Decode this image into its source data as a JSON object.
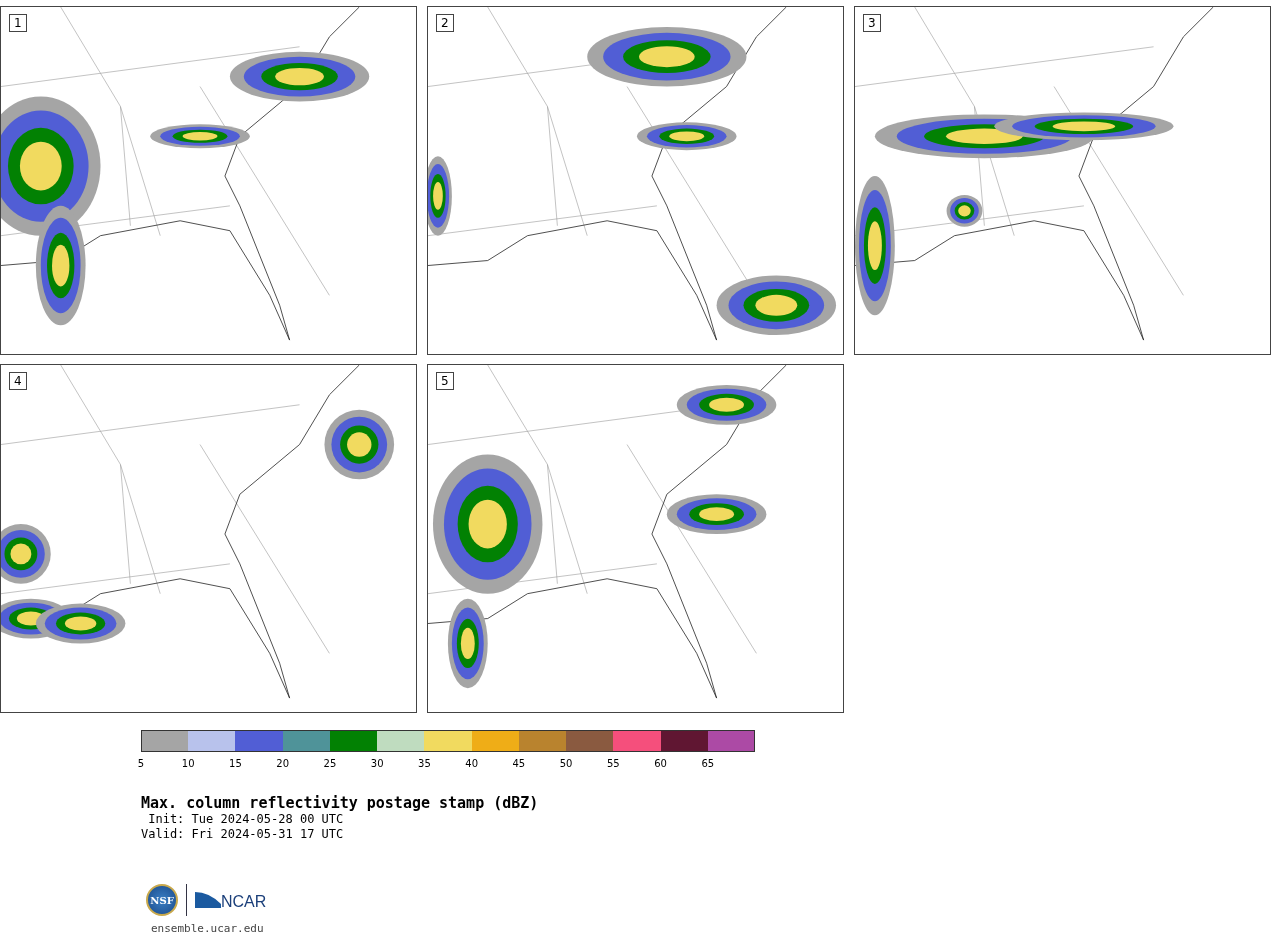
{
  "panels": [
    {
      "label": "1"
    },
    {
      "label": "2"
    },
    {
      "label": "3"
    },
    {
      "label": "4"
    },
    {
      "label": "5"
    }
  ],
  "colorbar": [
    {
      "label": "5",
      "color": "#a5a5a5"
    },
    {
      "label": "10",
      "color": "#b8c2ec"
    },
    {
      "label": "15",
      "color": "#515ed5"
    },
    {
      "label": "20",
      "color": "#4f9399"
    },
    {
      "label": "25",
      "color": "#028103"
    },
    {
      "label": "30",
      "color": "#bfdcbf"
    },
    {
      "label": "35",
      "color": "#f1da5f"
    },
    {
      "label": "40",
      "color": "#efad17"
    },
    {
      "label": "45",
      "color": "#b9832e"
    },
    {
      "label": "50",
      "color": "#8a5a40"
    },
    {
      "label": "55",
      "color": "#f54f7c"
    },
    {
      "label": "60",
      "color": "#601632"
    },
    {
      "label": "65",
      "color": "#ac4aa5"
    }
  ],
  "title": "Max. column reflectivity postage stamp (dBZ)",
  "init": " Init: Tue 2024-05-28 00 UTC",
  "valid": "Valid: Fri 2024-05-31 17 UTC",
  "logos": {
    "left": "NSF",
    "right": "NCAR"
  },
  "footer": "ensemble.ucar.edu"
}
